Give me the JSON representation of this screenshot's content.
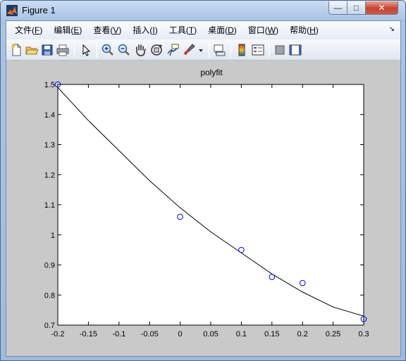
{
  "window": {
    "title": "Figure 1",
    "min": "—",
    "max": "□",
    "close": "✕"
  },
  "menu": [
    {
      "label": "文件(",
      "mn": "F",
      "end": ")"
    },
    {
      "label": "编辑(",
      "mn": "E",
      "end": ")"
    },
    {
      "label": "查看(",
      "mn": "V",
      "end": ")"
    },
    {
      "label": "插入(",
      "mn": "I",
      "end": ")"
    },
    {
      "label": "工具(",
      "mn": "T",
      "end": ")"
    },
    {
      "label": "桌面(",
      "mn": "D",
      "end": ")"
    },
    {
      "label": "窗口(",
      "mn": "W",
      "end": ")"
    },
    {
      "label": "帮助(",
      "mn": "H",
      "end": ")"
    }
  ],
  "menu_more": "↘",
  "toolbar_icons": [
    "new-figure-icon",
    "open-file-icon",
    "save-icon",
    "print-icon",
    "pointer-icon",
    "zoom-in-icon",
    "zoom-out-icon",
    "pan-hand-icon",
    "rotate-3d-icon",
    "data-cursor-icon",
    "brush-icon",
    "brush-dropdown-icon",
    "link-plot-icon",
    "colorbar-icon",
    "legend-icon",
    "hide-plot-tools-icon",
    "show-plot-tools-icon"
  ],
  "colors": {
    "marker": "#0000ff",
    "fit_line": "#000000",
    "axes_bg": "#ffffff",
    "figure_bg": "#c9c9c9"
  },
  "chart_data": {
    "type": "scatter",
    "title": "polyfit",
    "xlabel": "",
    "ylabel": "",
    "xlim": [
      -0.2,
      0.3
    ],
    "ylim": [
      0.7,
      1.5
    ],
    "xticks": [
      "-0.2",
      "-0.15",
      "-0.1",
      "-0.05",
      "0",
      "0.05",
      "0.1",
      "0.15",
      "0.2",
      "0.25",
      "0.3"
    ],
    "yticks": [
      "0.7",
      "0.8",
      "0.9",
      "1",
      "1.1",
      "1.2",
      "1.3",
      "1.4",
      "1.5"
    ],
    "grid": false,
    "series": [
      {
        "marker": "circle",
        "x": [
          -0.2,
          0,
          0.1,
          0.15,
          0.2,
          0.3
        ],
        "y": [
          1.5,
          1.06,
          0.95,
          0.86,
          0.84,
          0.72
        ]
      },
      {
        "line": "solid",
        "fit": "quadratic",
        "x": [
          -0.2,
          -0.15,
          -0.1,
          -0.05,
          0,
          0.05,
          0.1,
          0.15,
          0.2,
          0.25,
          0.3
        ],
        "y": [
          1.49,
          1.38,
          1.28,
          1.18,
          1.09,
          1.01,
          0.94,
          0.87,
          0.81,
          0.76,
          0.73
        ]
      }
    ]
  }
}
